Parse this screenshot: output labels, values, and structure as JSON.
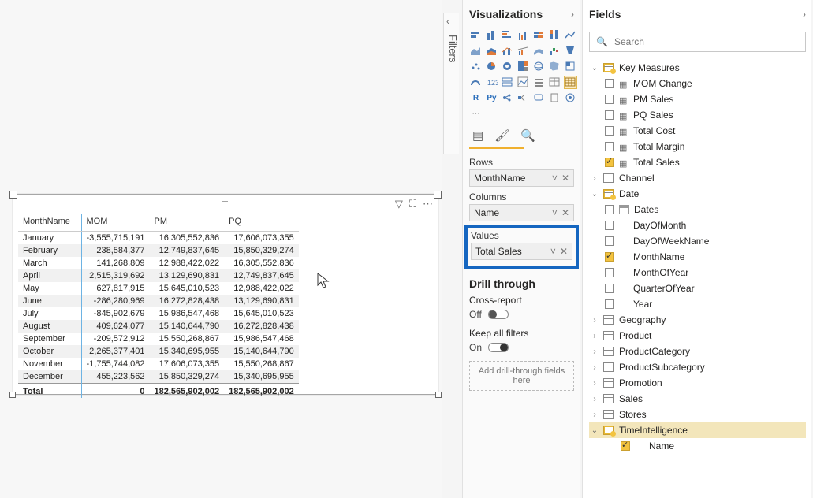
{
  "panes": {
    "visualizations": "Visualizations",
    "fields": "Fields",
    "filters": "Filters"
  },
  "search": {
    "placeholder": "Search"
  },
  "wells": {
    "rows_label": "Rows",
    "rows_value": "MonthName",
    "columns_label": "Columns",
    "columns_value": "Name",
    "values_label": "Values",
    "values_value": "Total Sales"
  },
  "drill": {
    "header": "Drill through",
    "cross_report": "Cross-report",
    "cross_state": "Off",
    "keep_filters": "Keep all filters",
    "keep_state": "On",
    "drop_hint": "Add drill-through fields here"
  },
  "matrix": {
    "headers": [
      "MonthName",
      "MOM",
      "PM",
      "PQ"
    ],
    "rows": [
      [
        "January",
        "-3,555,715,191",
        "16,305,552,836",
        "17,606,073,355"
      ],
      [
        "February",
        "238,584,377",
        "12,749,837,645",
        "15,850,329,274"
      ],
      [
        "March",
        "141,268,809",
        "12,988,422,022",
        "16,305,552,836"
      ],
      [
        "April",
        "2,515,319,692",
        "13,129,690,831",
        "12,749,837,645"
      ],
      [
        "May",
        "627,817,915",
        "15,645,010,523",
        "12,988,422,022"
      ],
      [
        "June",
        "-286,280,969",
        "16,272,828,438",
        "13,129,690,831"
      ],
      [
        "July",
        "-845,902,679",
        "15,986,547,468",
        "15,645,010,523"
      ],
      [
        "August",
        "409,624,077",
        "15,140,644,790",
        "16,272,828,438"
      ],
      [
        "September",
        "-209,572,912",
        "15,550,268,867",
        "15,986,547,468"
      ],
      [
        "October",
        "2,265,377,401",
        "15,340,695,955",
        "15,140,644,790"
      ],
      [
        "November",
        "-1,755,744,082",
        "17,606,073,355",
        "15,550,268,867"
      ],
      [
        "December",
        "455,223,562",
        "15,850,329,274",
        "15,340,695,955"
      ]
    ],
    "total": [
      "Total",
      "0",
      "182,565,902,002",
      "182,565,902,002"
    ]
  },
  "fields_tree": {
    "key_measures": {
      "label": "Key Measures",
      "items": [
        {
          "label": "MOM Change",
          "checked": false
        },
        {
          "label": "PM Sales",
          "checked": false
        },
        {
          "label": "PQ Sales",
          "checked": false
        },
        {
          "label": "Total Cost",
          "checked": false
        },
        {
          "label": "Total Margin",
          "checked": false
        },
        {
          "label": "Total Sales",
          "checked": true
        }
      ]
    },
    "channel": "Channel",
    "date": {
      "label": "Date",
      "items": [
        {
          "label": "Dates",
          "checked": false,
          "icon": "date"
        },
        {
          "label": "DayOfMonth",
          "checked": false
        },
        {
          "label": "DayOfWeekName",
          "checked": false
        },
        {
          "label": "MonthName",
          "checked": true
        },
        {
          "label": "MonthOfYear",
          "checked": false
        },
        {
          "label": "QuarterOfYear",
          "checked": false
        },
        {
          "label": "Year",
          "checked": false
        }
      ]
    },
    "geography": "Geography",
    "product": "Product",
    "product_category": "ProductCategory",
    "product_subcategory": "ProductSubcategory",
    "promotion": "Promotion",
    "sales": "Sales",
    "stores": "Stores",
    "time_intelligence": "TimeIntelligence",
    "ti_name": "Name"
  }
}
